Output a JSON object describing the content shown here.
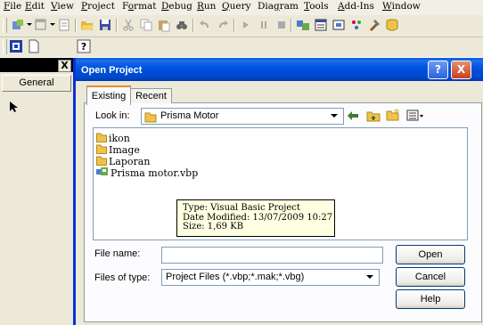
{
  "menu": {
    "items": [
      {
        "label": "File"
      },
      {
        "label": "Edit"
      },
      {
        "label": "View"
      },
      {
        "label": "Project"
      },
      {
        "label": "Format"
      },
      {
        "label": "Debug"
      },
      {
        "label": "Run"
      },
      {
        "label": "Query"
      },
      {
        "label": "Diagram"
      },
      {
        "label": "Tools"
      },
      {
        "label": "Add-Ins"
      },
      {
        "label": "Window"
      }
    ]
  },
  "toolbox": {
    "close_label": "X",
    "general_label": "General"
  },
  "dialog": {
    "title": "Open Project",
    "help_label": "?",
    "close_label": "X",
    "tabs": [
      {
        "label": "Existing"
      },
      {
        "label": "Recent"
      }
    ],
    "look_in_label": "Look in:",
    "look_in_value": "Prisma Motor",
    "files": [
      {
        "name": "ikon",
        "icon": "folder-icon"
      },
      {
        "name": "Image",
        "icon": "folder-icon"
      },
      {
        "name": "Laporan",
        "icon": "folder-icon"
      },
      {
        "name": "Prisma motor.vbp",
        "icon": "vb-project-icon"
      }
    ],
    "tooltip": {
      "type": "Type: Visual Basic Project",
      "modified": "Date Modified: 13/07/2009 10:27",
      "size": "Size: 1,69 KB"
    },
    "file_name_label": "File name:",
    "file_name_value": "",
    "files_of_type_label": "Files of type:",
    "files_of_type_value": "Project Files (*.vbp;*.mak;*.vbg)",
    "buttons": {
      "open": "Open",
      "cancel": "Cancel",
      "help": "Help"
    }
  },
  "colors": {
    "titlebar": "#0054e3",
    "tooltip_bg": "#ffffe1",
    "folder": "#f0c24a"
  }
}
